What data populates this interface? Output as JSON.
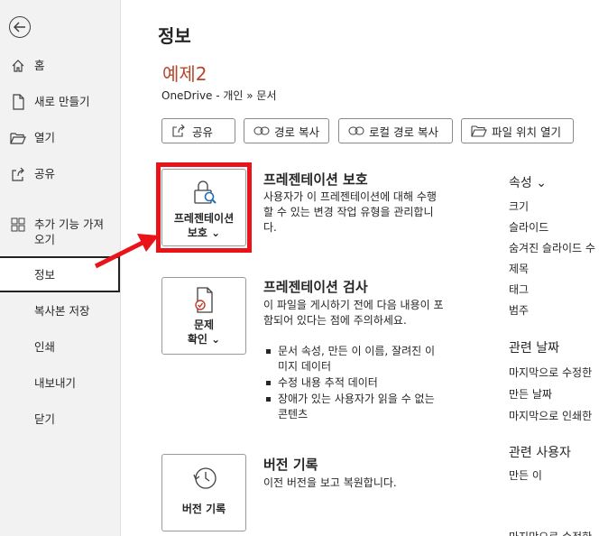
{
  "sidebar": {
    "back_icon": "back-arrow-icon",
    "items": [
      {
        "label": "홈",
        "icon": "home-icon"
      },
      {
        "label": "새로 만들기",
        "icon": "new-file-icon"
      },
      {
        "label": "열기",
        "icon": "folder-open-icon"
      },
      {
        "label": "공유",
        "icon": "share-icon"
      },
      {
        "label": "추가 기능 가져\n오기",
        "icon": "addins-grid-icon"
      },
      {
        "label": "정보"
      },
      {
        "label": "복사본 저장"
      },
      {
        "label": "인쇄"
      },
      {
        "label": "내보내기"
      },
      {
        "label": "닫기"
      }
    ],
    "active": "정보"
  },
  "main": {
    "title": "정보",
    "doc_name": "예제2",
    "doc_path": "OneDrive - 개인 » 문서",
    "toolbar": {
      "share": "공유",
      "copy_path": "경로 복사",
      "copy_local_path": "로컬 경로 복사",
      "open_file_location": "파일 위치 열기"
    },
    "protect": {
      "button_line1": "프레젠테이션",
      "button_line2": "보호",
      "title": "프레젠테이션 보호",
      "desc": "사용자가 이 프레젠테이션에 대해 수행할 수 있는 변경 작업 유형을 관리합니다."
    },
    "inspect": {
      "button_line1": "문제",
      "button_line2": "확인",
      "title": "프레젠테이션 검사",
      "desc": "이 파일을 게시하기 전에 다음 내용이 포함되어 있다는 점에 주의하세요.",
      "bullets": [
        "문서 속성, 만든 이 이름, 잘려진 이미지 데이터",
        "수정 내용 추적 데이터",
        "장애가 있는 사용자가 읽을 수 없는 콘텐츠"
      ]
    },
    "versions": {
      "button_label": "버전 기록",
      "title": "버전 기록",
      "desc": "이전 버전을 보고 복원합니다."
    }
  },
  "properties": {
    "header": "속성",
    "items": [
      "크기",
      "슬라이드",
      "숨겨진 슬라이드 수",
      "제목",
      "태그",
      "범주"
    ],
    "dates_header": "관련 날짜",
    "dates": [
      "마지막으로 수정한",
      "만든 날짜",
      "마지막으로 인쇄한"
    ],
    "people_header": "관련 사용자",
    "people": [
      "만든 이"
    ],
    "partial_bottom": "마지막으로 수정한"
  },
  "colors": {
    "accent_title": "#b7472a",
    "highlight": "#e8141a"
  }
}
